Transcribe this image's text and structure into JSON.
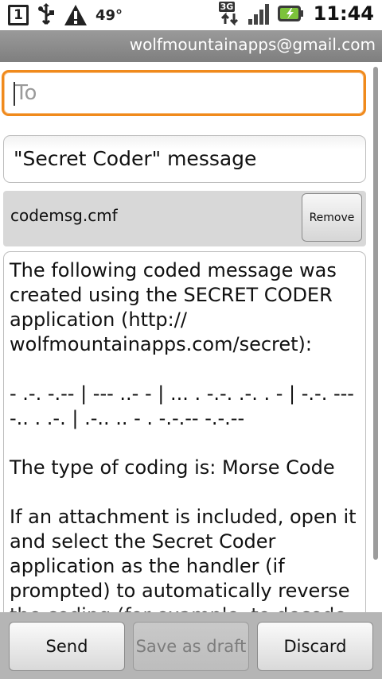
{
  "status_bar": {
    "notification_count": "1",
    "temperature": "49°",
    "network_type": "3G",
    "time": "11:44",
    "icons": [
      "notification-count-icon",
      "usb-icon",
      "warning-icon",
      "3g-data-icon",
      "signal-icon",
      "battery-charging-icon"
    ]
  },
  "account": {
    "email": "wolfmountainapps@gmail.com"
  },
  "compose": {
    "to_placeholder": "To",
    "subject": "\"Secret Coder\" message",
    "attachment_name": "codemsg.cmf",
    "remove_label": "Remove",
    "body_paragraphs": [
      "The following coded message was created using the SECRET CODER application (http:// wolfmountainapps.com/secret):",
      "- .-. -.-- | --- ..- - | ... . -.-. .-. . - | -.-. --- -.. . .-. | .-.. .. - . -.-.-- -.-.--",
      "The type of coding is: Morse Code",
      "If an attachment is included, open it and select the Secret Coder application as the handler (if prompted) to automatically reverse the coding (for example, to decode"
    ]
  },
  "actions": {
    "send_label": "Send",
    "save_draft_label": "Save as draft",
    "discard_label": "Discard"
  },
  "colors": {
    "focus_border": "#f08a1c",
    "account_bar": "#8c8c8c",
    "bottom_bar": "#b5b5b5"
  }
}
